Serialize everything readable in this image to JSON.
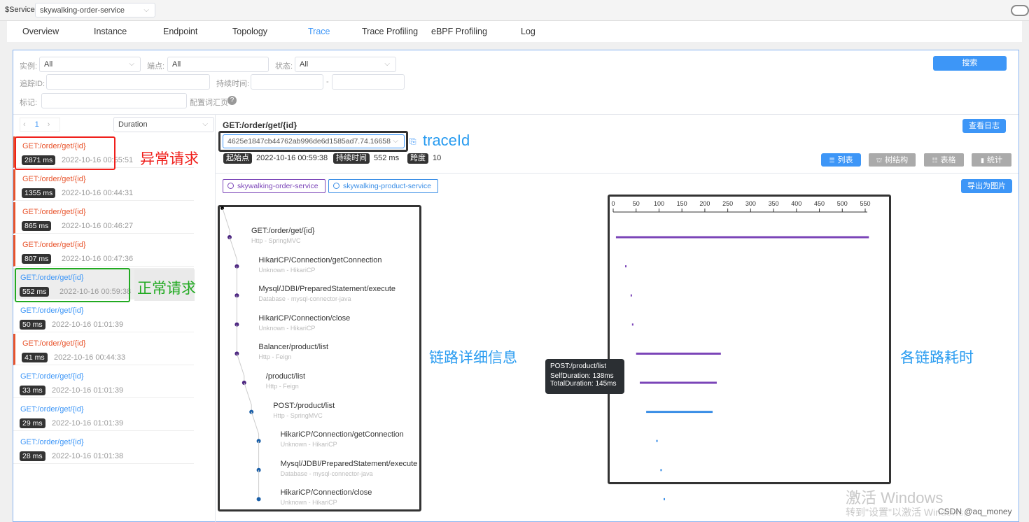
{
  "header": {
    "service_label": "$Service",
    "service_value": "skywalking-order-service"
  },
  "tabs": [
    "Overview",
    "Instance",
    "Endpoint",
    "Topology",
    "Trace",
    "Trace Profiling",
    "eBPF Profiling",
    "Log"
  ],
  "active_tab": "Trace",
  "filters": {
    "instance_label": "实例:",
    "instance_value": "All",
    "endpoint_label": "端点:",
    "endpoint_value": "All",
    "status_label": "状态:",
    "status_value": "All",
    "traceid_label": "追踪ID:",
    "duration_label": "持续时间:",
    "duration_sep": "-",
    "tags_label": "标记:",
    "vocab_link": "配置词汇页",
    "search_button": "搜索"
  },
  "list": {
    "page": "1",
    "sort": "Duration",
    "items": [
      {
        "endpoint": "GET:/order/get/{id}",
        "duration": "2871 ms",
        "time": "2022-10-16 00:55:51",
        "error": true
      },
      {
        "endpoint": "GET:/order/get/{id}",
        "duration": "1355 ms",
        "time": "2022-10-16 00:44:31",
        "error": true
      },
      {
        "endpoint": "GET:/order/get/{id}",
        "duration": "865 ms",
        "time": "2022-10-16 00:46:27",
        "error": true
      },
      {
        "endpoint": "GET:/order/get/{id}",
        "duration": "807 ms",
        "time": "2022-10-16 00:47:36",
        "error": true
      },
      {
        "endpoint": "GET:/order/get/{id}",
        "duration": "552 ms",
        "time": "2022-10-16 00:59:38",
        "error": false,
        "selected": true
      },
      {
        "endpoint": "GET:/order/get/{id}",
        "duration": "50 ms",
        "time": "2022-10-16 01:01:39",
        "error": false
      },
      {
        "endpoint": "GET:/order/get/{id}",
        "duration": "41 ms",
        "time": "2022-10-16 00:44:33",
        "error": true
      },
      {
        "endpoint": "GET:/order/get/{id}",
        "duration": "33 ms",
        "time": "2022-10-16 01:01:39",
        "error": false
      },
      {
        "endpoint": "GET:/order/get/{id}",
        "duration": "29 ms",
        "time": "2022-10-16 01:01:39",
        "error": false
      },
      {
        "endpoint": "GET:/order/get/{id}",
        "duration": "28 ms",
        "time": "2022-10-16 01:01:38",
        "error": false
      }
    ]
  },
  "detail": {
    "title": "GET:/order/get/{id}",
    "trace_id": "4625e1847cb44762ab996de6d1585ad7.74.16658",
    "view_logs": "查看日志",
    "start_label": "起始点",
    "start_value": "2022-10-16 00:59:38",
    "duration_label": "持续时间",
    "duration_value": "552 ms",
    "spans_label": "跨度",
    "spans_value": "10",
    "views": [
      "列表",
      "树结构",
      "表格",
      "统计"
    ],
    "active_view": "列表",
    "export": "导出为图片",
    "services": [
      {
        "name": "skywalking-order-service",
        "color": "#7b45b8"
      },
      {
        "name": "skywalking-product-service",
        "color": "#3a8ee6"
      }
    ],
    "axis_ticks": [
      "0",
      "50",
      "100",
      "150",
      "200",
      "250",
      "300",
      "350",
      "400",
      "450",
      "500",
      "550"
    ],
    "spans": [
      {
        "name": "GET:/order/get/{id}",
        "sub": "Http - SpringMVC",
        "depth": 0,
        "svc": 0,
        "start": 6,
        "end": 558
      },
      {
        "name": "HikariCP/Connection/getConnection",
        "sub": "Unknown - HikariCP",
        "depth": 1,
        "svc": 0,
        "start": 26,
        "end": 27
      },
      {
        "name": "Mysql/JDBI/PreparedStatement/execute",
        "sub": "Database - mysql-connector-java",
        "depth": 1,
        "svc": 0,
        "start": 38,
        "end": 39
      },
      {
        "name": "HikariCP/Connection/close",
        "sub": "Unknown - HikariCP",
        "depth": 1,
        "svc": 0,
        "start": 41,
        "end": 41.5
      },
      {
        "name": "Balancer/product/list",
        "sub": "Http - Feign",
        "depth": 1,
        "svc": 0,
        "start": 50,
        "end": 235
      },
      {
        "name": "/product/list",
        "sub": "Http - Feign",
        "depth": 2,
        "svc": 0,
        "start": 58,
        "end": 226
      },
      {
        "name": "POST:/product/list",
        "sub": "Http - SpringMVC",
        "depth": 3,
        "svc": 1,
        "start": 72,
        "end": 217
      },
      {
        "name": "HikariCP/Connection/getConnection",
        "sub": "Unknown - HikariCP",
        "depth": 4,
        "svc": 1,
        "start": 94,
        "end": 96
      },
      {
        "name": "Mysql/JDBI/PreparedStatement/execute",
        "sub": "Database - mysql-connector-java",
        "depth": 4,
        "svc": 1,
        "start": 103,
        "end": 104.5
      },
      {
        "name": "HikariCP/Connection/close",
        "sub": "Unknown - HikariCP",
        "depth": 4,
        "svc": 1,
        "start": 110,
        "end": 110.5
      }
    ],
    "tooltip": {
      "title": "POST:/product/list",
      "self": "SelfDuration: 138ms",
      "total": "TotalDuration: 145ms"
    }
  },
  "annotations": {
    "abnormal": "异常请求",
    "normal": "正常请求",
    "traceid": "traceId",
    "detail": "链路详细信息",
    "timing": "各链路耗时"
  },
  "watermark": {
    "line1": "激活 Windows",
    "line2": "转到\"设置\"以激活 Windows。",
    "csdn": "CSDN @aq_money"
  }
}
